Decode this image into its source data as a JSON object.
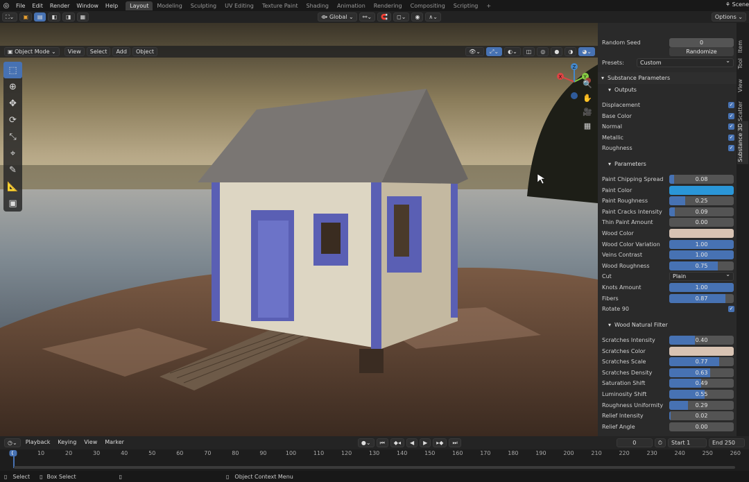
{
  "menubar": {
    "items": [
      "File",
      "Edit",
      "Render",
      "Window",
      "Help"
    ],
    "workspaces": [
      "Layout",
      "Modeling",
      "Sculpting",
      "UV Editing",
      "Texture Paint",
      "Shading",
      "Animation",
      "Rendering",
      "Compositing",
      "Scripting"
    ],
    "active_workspace": "Layout",
    "add_tab": "+",
    "scene_label": "Scene"
  },
  "header": {
    "transform": "Global",
    "options": "Options"
  },
  "viewport_header": {
    "mode": "Object Mode",
    "menus": [
      "View",
      "Select",
      "Add",
      "Object"
    ]
  },
  "gizmo": {
    "x": "X",
    "y": "Y",
    "z": "Z"
  },
  "npanel": {
    "tabs": [
      "Item",
      "Tool",
      "View",
      "Scatter",
      "Substance 3D"
    ],
    "active_tab": "Substance 3D",
    "random_seed_label": "Random Seed",
    "random_seed_value": "0",
    "randomize_label": "Randomize",
    "presets_label": "Presets:",
    "presets_value": "Custom",
    "substance_params_title": "Substance Parameters",
    "outputs_title": "Outputs",
    "outputs": [
      {
        "label": "Displacement",
        "checked": true
      },
      {
        "label": "Base Color",
        "checked": true
      },
      {
        "label": "Normal",
        "checked": true
      },
      {
        "label": "Metallic",
        "checked": true
      },
      {
        "label": "Roughness",
        "checked": true
      }
    ],
    "parameters_title": "Parameters",
    "parameters": [
      {
        "label": "Paint Chipping Spread",
        "value": "0.08",
        "fill": 0.08,
        "kind": "slider"
      },
      {
        "label": "Paint Color",
        "value": "",
        "color": "#2a96d8",
        "kind": "color"
      },
      {
        "label": "Paint Roughness",
        "value": "0.25",
        "fill": 0.25,
        "kind": "slider"
      },
      {
        "label": "Paint Cracks Intensity",
        "value": "0.09",
        "fill": 0.09,
        "kind": "slider"
      },
      {
        "label": "Thin Paint Amount",
        "value": "0.00",
        "fill": 0,
        "kind": "slider"
      },
      {
        "label": "Wood Color",
        "value": "",
        "color": "#d8c3b3",
        "kind": "color"
      },
      {
        "label": "Wood Color Variation",
        "value": "1.00",
        "fill": 1,
        "kind": "slider"
      },
      {
        "label": "Veins Contrast",
        "value": "1.00",
        "fill": 1,
        "kind": "slider"
      },
      {
        "label": "Wood Roughness",
        "value": "0.75",
        "fill": 0.75,
        "kind": "slider"
      },
      {
        "label": "Cut",
        "value": "Plain",
        "kind": "select"
      },
      {
        "label": "Knots Amount",
        "value": "1.00",
        "fill": 1,
        "kind": "slider"
      },
      {
        "label": "Fibers",
        "value": "0.87",
        "fill": 0.87,
        "kind": "slider"
      },
      {
        "label": "Rotate 90",
        "value": "",
        "checked": true,
        "kind": "check"
      }
    ],
    "filter_title": "Wood Natural Filter",
    "filter": [
      {
        "label": "Scratches Intensity",
        "value": "0.40",
        "fill": 0.4,
        "kind": "slider"
      },
      {
        "label": "Scratches Color",
        "value": "",
        "color": "#d8c3b3",
        "kind": "color"
      },
      {
        "label": "Scratches Scale",
        "value": "0.77",
        "fill": 0.77,
        "kind": "slider"
      },
      {
        "label": "Scratches Density",
        "value": "0.63",
        "fill": 0.63,
        "kind": "slider"
      },
      {
        "label": "Saturation Shift",
        "value": "0.49",
        "fill": 0.49,
        "kind": "slider"
      },
      {
        "label": "Luminosity Shift",
        "value": "0.55",
        "fill": 0.55,
        "kind": "slider"
      },
      {
        "label": "Roughness Uniformity",
        "value": "0.29",
        "fill": 0.29,
        "kind": "slider"
      },
      {
        "label": "Relief Intensity",
        "value": "0.02",
        "fill": 0.02,
        "kind": "slider"
      },
      {
        "label": "Relief Angle",
        "value": "0.00",
        "fill": 0,
        "kind": "slider"
      }
    ]
  },
  "timeline": {
    "menus": [
      "Playback",
      "Keying",
      "View",
      "Marker"
    ],
    "current_frame": "0",
    "start_label": "Start",
    "start_value": "1",
    "end_label": "End",
    "end_value": "250",
    "ticks": [
      "0",
      "10",
      "20",
      "30",
      "40",
      "50",
      "60",
      "70",
      "80",
      "90",
      "100",
      "110",
      "120",
      "130",
      "140",
      "150",
      "160",
      "170",
      "180",
      "190",
      "200",
      "210",
      "220",
      "230",
      "240",
      "250",
      "260"
    ]
  },
  "status": {
    "select": "Select",
    "box_select": "Box Select",
    "context_menu": "Object Context Menu"
  },
  "colors": {
    "accent": "#4772b3",
    "paint": "#2a96d8",
    "wood": "#d8c3b3"
  }
}
